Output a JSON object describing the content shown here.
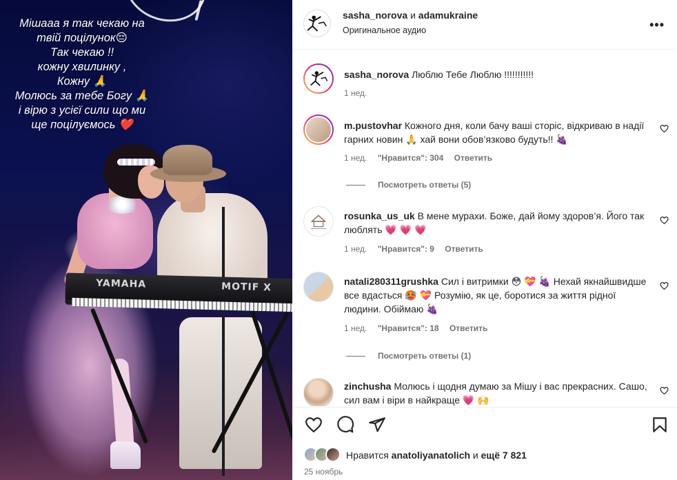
{
  "story": {
    "caption_lines": [
      "Мішааа я так чекаю на",
      "твій поцілунок😔",
      "Так чекаю !!",
      "кожну  хвилинку  ,",
      "Кожну 🙏",
      "Молюсь за тебе Богу 🙏",
      "і вірю з усієї сили що ми",
      "ще поцілуємось ❤️"
    ],
    "keyboard_brand": "YAMAHA",
    "keyboard_model": "MOTIF X"
  },
  "header": {
    "author": "sasha_norova",
    "joiner": "и",
    "coauthor": "adamukraine",
    "audio": "Оригинальное аудио",
    "more_label": "•••"
  },
  "caption_comment": {
    "user": "sasha_norova",
    "text": "Люблю Тебе Люблю !!!!!!!!!!!",
    "time": "1 нед."
  },
  "comments": [
    {
      "user": "m.pustovhar",
      "text": "Кожного дня, коли бачу ваші сторіс, відкриваю в надії гарних новин 🙏 хай вони обов’язково будуть!! 🍇",
      "time": "1 нед.",
      "likes": "\"Нравится\": 304",
      "reply": "Ответить",
      "view_replies": "Посмотреть ответы (5)"
    },
    {
      "user": "rosunka_us_uk",
      "text": "В мене мурахи. Боже, дай йому здоров’я. Його так люблять 💗 💗 💗",
      "time": "1 нед.",
      "likes": "\"Нравится\": 9",
      "reply": "Ответить"
    },
    {
      "user": "natali280311grushka",
      "text": "Сил і витримки 😳 💝 🍇 Нехай якнайшвидше все вдасться 🥵 💝 Розумію, як це, боротися за життя рідної людини. Обіймаю 🍇",
      "time": "1 нед.",
      "likes": "\"Нравится\": 18",
      "reply": "Ответить",
      "view_replies": "Посмотреть ответы (1)"
    },
    {
      "user": "zinchusha",
      "text": "Молюсь і щодня думаю за Мішу і вас прекрасних. Сашо, сил вам і віри в найкраще 💗 🙌"
    }
  ],
  "actions": {
    "like_icon": "heart-icon",
    "comment_icon": "comment-icon",
    "share_icon": "paper-plane-icon",
    "save_icon": "bookmark-icon"
  },
  "likes": {
    "prefix": "Нравится",
    "user": "anatoliyanatolich",
    "joiner": "и",
    "rest": "ещё 7 821"
  },
  "date": "25 ноябрь",
  "colors": {
    "ring_start": "#f9ce34",
    "ring_mid": "#ee2a7b",
    "ring_end": "#6228d7",
    "text_primary": "#262626",
    "text_secondary": "#737373"
  }
}
